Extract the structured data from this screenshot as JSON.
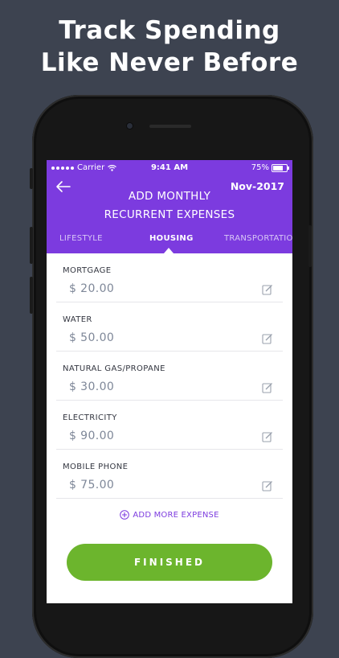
{
  "promo": {
    "line1": "Track Spending",
    "line2": "Like Never Before"
  },
  "status_bar": {
    "carrier": "Carrier",
    "time": "9:41 AM",
    "battery": "75%"
  },
  "header": {
    "month": "Nov-2017",
    "title_line1": "ADD MONTHLY",
    "title_line2": "RECURRENT EXPENSES"
  },
  "tabs": [
    {
      "label": "LIFESTYLE",
      "active": false
    },
    {
      "label": "HOUSING",
      "active": true
    },
    {
      "label": "TRANSPORTATIO",
      "active": false
    }
  ],
  "expenses": [
    {
      "name": "MORTGAGE",
      "amount": "$ 20.00"
    },
    {
      "name": "WATER",
      "amount": "$ 50.00"
    },
    {
      "name": "NATURAL GAS/PROPANE",
      "amount": "$ 30.00"
    },
    {
      "name": "ELECTRICITY",
      "amount": "$ 90.00"
    },
    {
      "name": "MOBILE PHONE",
      "amount": "$ 75.00"
    }
  ],
  "actions": {
    "add_more": "ADD MORE EXPENSE",
    "finish": "FINISHED"
  },
  "colors": {
    "accent": "#7c3bdf",
    "finish": "#6cb52d",
    "background": "#3d4350"
  },
  "icons": [
    "back-arrow-icon",
    "wifi-icon",
    "battery-icon",
    "edit-icon",
    "plus-circle-icon"
  ]
}
